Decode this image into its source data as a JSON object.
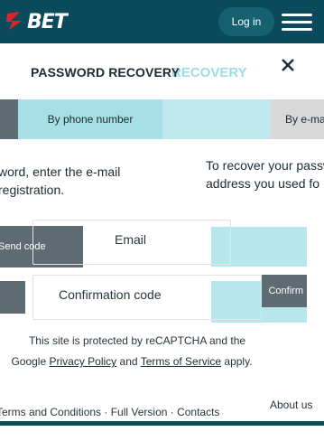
{
  "header": {
    "logo_text": "BET",
    "login_label": "Log in",
    "colors": {
      "background": "#0b4a5a",
      "logo_accent": "#e8202a"
    }
  },
  "modal": {
    "title": "PASSWORD RECOVERY",
    "title_ghost": "RECOVERY",
    "tabs": {
      "phone": "By phone number",
      "email": "By e-mail"
    },
    "description_left": [
      "word, enter the e-mail",
      "registration."
    ],
    "description_right": [
      "To recover your passw",
      "address you used fo"
    ],
    "fields": {
      "email": {
        "placeholder": "Email"
      },
      "confirmation": {
        "placeholder": "Confirmation code"
      }
    },
    "buttons": {
      "send_code": "Send code",
      "confirm": "Confirm"
    }
  },
  "recaptcha": {
    "line1": "This site is protected by reCAPTCHA and the",
    "prefix": "Google",
    "privacy": "Privacy Policy",
    "and": "and",
    "terms": "Terms of Service",
    "suffix": "apply."
  },
  "footer": {
    "about": "About us",
    "links": "Terms and Conditions · Full Version · Contacts"
  }
}
